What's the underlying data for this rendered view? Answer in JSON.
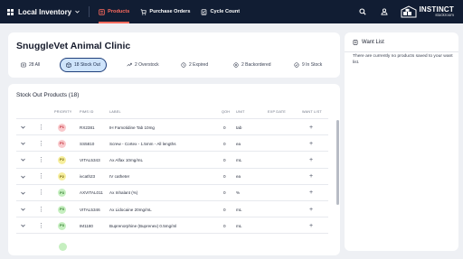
{
  "nav": {
    "brand": "Local Inventory",
    "links": [
      {
        "label": "Products",
        "icon": "products-icon",
        "active": true
      },
      {
        "label": "Purchase Orders",
        "icon": "purchase-orders-icon",
        "active": false
      },
      {
        "label": "Cycle Count",
        "icon": "cycle-count-icon",
        "active": false
      }
    ],
    "logo_line1": "INSTINCT",
    "logo_line2": "stockroom"
  },
  "clinic": {
    "title": "SnuggleVet Animal Clinic",
    "filters": [
      {
        "label": "28 All",
        "icon": "list-icon",
        "active": false
      },
      {
        "label": "18 Stock Out",
        "icon": "stock-out-icon",
        "active": true
      },
      {
        "label": "2 Overstock",
        "icon": "overstock-icon",
        "active": false
      },
      {
        "label": "2 Expired",
        "icon": "expired-icon",
        "active": false
      },
      {
        "label": "2 Backordered",
        "icon": "backordered-icon",
        "active": false
      },
      {
        "label": "9 In Stock",
        "icon": "in-stock-icon",
        "active": false
      }
    ]
  },
  "stock": {
    "title": "Stock Out Products (18)",
    "columns": {
      "priority": "PRIORITY",
      "pimsid": "PIMS ID",
      "label": "LABEL",
      "qoh": "QOH",
      "unit": "UNIT",
      "exp_date": "EXP DATE",
      "want_list": "WANT LIST"
    },
    "rows": [
      {
        "priority": "P1",
        "pimsid": "RX2381",
        "label": "IH Famotidine Tab 10mg",
        "qoh": "0",
        "unit": "tab"
      },
      {
        "priority": "P1",
        "pimsid": "SS5810",
        "label": "Screw - Cortex - 1.5mm - All lengths",
        "qoh": "0",
        "unit": "ea"
      },
      {
        "priority": "P2",
        "pimsid": "VITAL5343",
        "label": "Ax Alfax 10mg/mL",
        "qoh": "0",
        "unit": "mL"
      },
      {
        "priority": "P2",
        "pimsid": "ivcath23",
        "label": "IV catheter",
        "qoh": "0",
        "unit": "ea"
      },
      {
        "priority": "P3",
        "pimsid": "AXVITAL011",
        "label": "Ax Inhalant (%)",
        "qoh": "0",
        "unit": "%"
      },
      {
        "priority": "P3",
        "pimsid": "VITAL5346",
        "label": "Ax Lidocaine 20mg/mL",
        "qoh": "0",
        "unit": "mL"
      },
      {
        "priority": "P3",
        "pimsid": "IM1180",
        "label": "Buprenorphine (Buprenex) 0.5mg/ml",
        "qoh": "0",
        "unit": "mL"
      }
    ]
  },
  "want_list": {
    "title": "Want List",
    "empty_text": "There are currently no products saved to your want list."
  },
  "colors": {
    "nav_bg": "#111d33",
    "accent": "#ff6b5e",
    "active_filter_bg": "#cfe4fb",
    "p1_bg": "#f9c9cc",
    "p1_fg": "#c0242f",
    "p2_bg": "#f6ee9c",
    "p2_fg": "#6b5a00",
    "p3_bg": "#c6efc0",
    "p3_fg": "#2f7a2a"
  }
}
